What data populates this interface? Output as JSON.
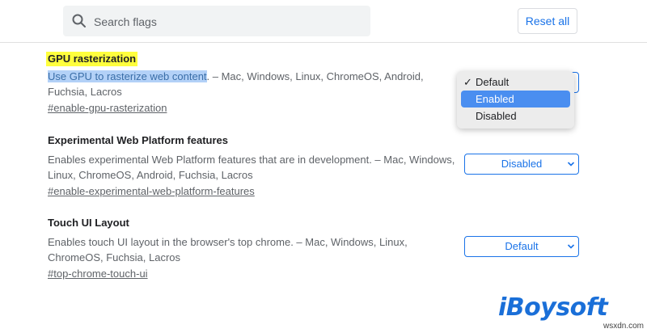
{
  "header": {
    "search_placeholder": "Search flags",
    "reset_label": "Reset all"
  },
  "flags": [
    {
      "title": "GPU rasterization",
      "desc_selected": "Use GPU to rasterize web content",
      "desc_rest": ". – Mac, Windows, Linux, ChromeOS, Android, Fuchsia, Lacros",
      "link": "#enable-gpu-rasterization",
      "value": "Default"
    },
    {
      "title": "Experimental Web Platform features",
      "desc": "Enables experimental Web Platform features that are in development. – Mac, Windows, Linux, ChromeOS, Android, Fuchsia, Lacros",
      "link": "#enable-experimental-web-platform-features",
      "value": "Disabled"
    },
    {
      "title": "Touch UI Layout",
      "desc": "Enables touch UI layout in the browser's top chrome. – Mac, Windows, Linux, ChromeOS, Fuchsia, Lacros",
      "link": "#top-chrome-touch-ui",
      "value": "Default"
    }
  ],
  "dropdown": {
    "options": [
      "Default",
      "Enabled",
      "Disabled"
    ],
    "checked": "Default",
    "highlighted": "Enabled",
    "check_glyph": "✓"
  },
  "watermark": {
    "logo_text": "iBoysoft",
    "site": "wsxdn.com"
  },
  "colors": {
    "accent": "#1a73e8",
    "highlight_yellow": "#ffff3d",
    "dropdown_active": "#4a8ef0"
  }
}
